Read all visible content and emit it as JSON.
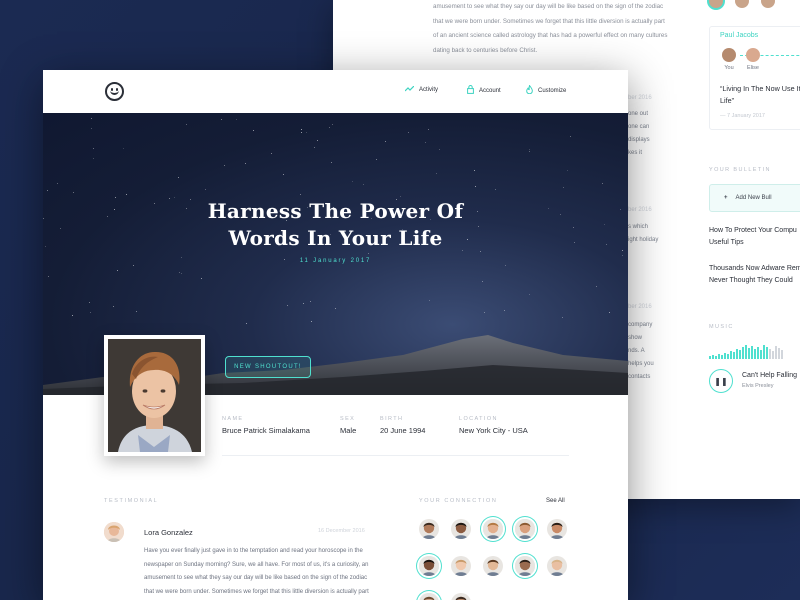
{
  "back_page": {
    "paragraph": "amusement to see what they say our day will be like based on the sign of the zodiac that we were born under. Sometimes we forget that this little diversion is actually part of an ancient science called astrology that has had a powerful effect on many cultures dating back to centuries before Christ.",
    "fragments": [
      {
        "text": "mber 2016",
        "date": true
      },
      {
        "text": "one out"
      },
      {
        "text": "one can"
      },
      {
        "text": "displays"
      },
      {
        "text": "kes it"
      },
      {
        "text": "mber 2016",
        "date": true
      },
      {
        "text": "s which"
      },
      {
        "text": "ight holiday"
      },
      {
        "text": "mber 2016",
        "date": true
      },
      {
        "text": "company"
      },
      {
        "text": "show"
      },
      {
        "text": "nds. A"
      },
      {
        "text": "helps you"
      },
      {
        "text": "contacts"
      }
    ]
  },
  "right_col": {
    "card": {
      "name": "Paul Jacobs",
      "person_a": "You",
      "person_b": "Elise",
      "quote": "“Living In The Now Use It Your Life”",
      "date": "— 7 January 2017"
    },
    "bulletin_label": "YOUR BULLETIN",
    "add_button": "Add New Bull",
    "bulletins": [
      "How To Protect Your Compu",
      "Useful Tips",
      "Thousands Now Adware Rem",
      "Never Thought They Could"
    ],
    "music_label": "MUSIC",
    "song": "Can't Help Falling",
    "artist": "Elvis Presley",
    "play_icon": "pause-icon"
  },
  "nav": {
    "items": [
      {
        "label": "Activity",
        "icon": "activity-icon"
      },
      {
        "label": "Account",
        "icon": "lock-icon"
      },
      {
        "label": "Customize",
        "icon": "fire-icon"
      }
    ]
  },
  "hero": {
    "title_line1": "Harness The Power Of",
    "title_line2": "Words In Your Life",
    "date": "11 January 2017",
    "shoutout": "NEW SHOUTOUT!"
  },
  "profile": {
    "fields": [
      {
        "key": "NAME",
        "value": "Bruce Patrick Simalakama"
      },
      {
        "key": "SEX",
        "value": "Male"
      },
      {
        "key": "BIRTH",
        "value": "20 June 1994"
      },
      {
        "key": "LOCATION",
        "value": "New York City - USA"
      }
    ]
  },
  "testimonial": {
    "label": "TESTIMONIAL",
    "name": "Lora Gonzalez",
    "date": "16 December 2016",
    "body": "Have you ever finally just gave in to the temptation and read your horoscope in the newspaper on Sunday morning? Sure, we all have. For most of us, it's a curiosity, an amusement to see what they say our day will be like based on the sign of the zodiac that we were born under. Sometimes we forget that this little diversion is actually part"
  },
  "connection": {
    "label": "YOUR CONNECTION",
    "see_all": "See All"
  },
  "colors": {
    "accent": "#4fe0cf",
    "background": "#1b2a52",
    "text": "#2b2f38"
  }
}
